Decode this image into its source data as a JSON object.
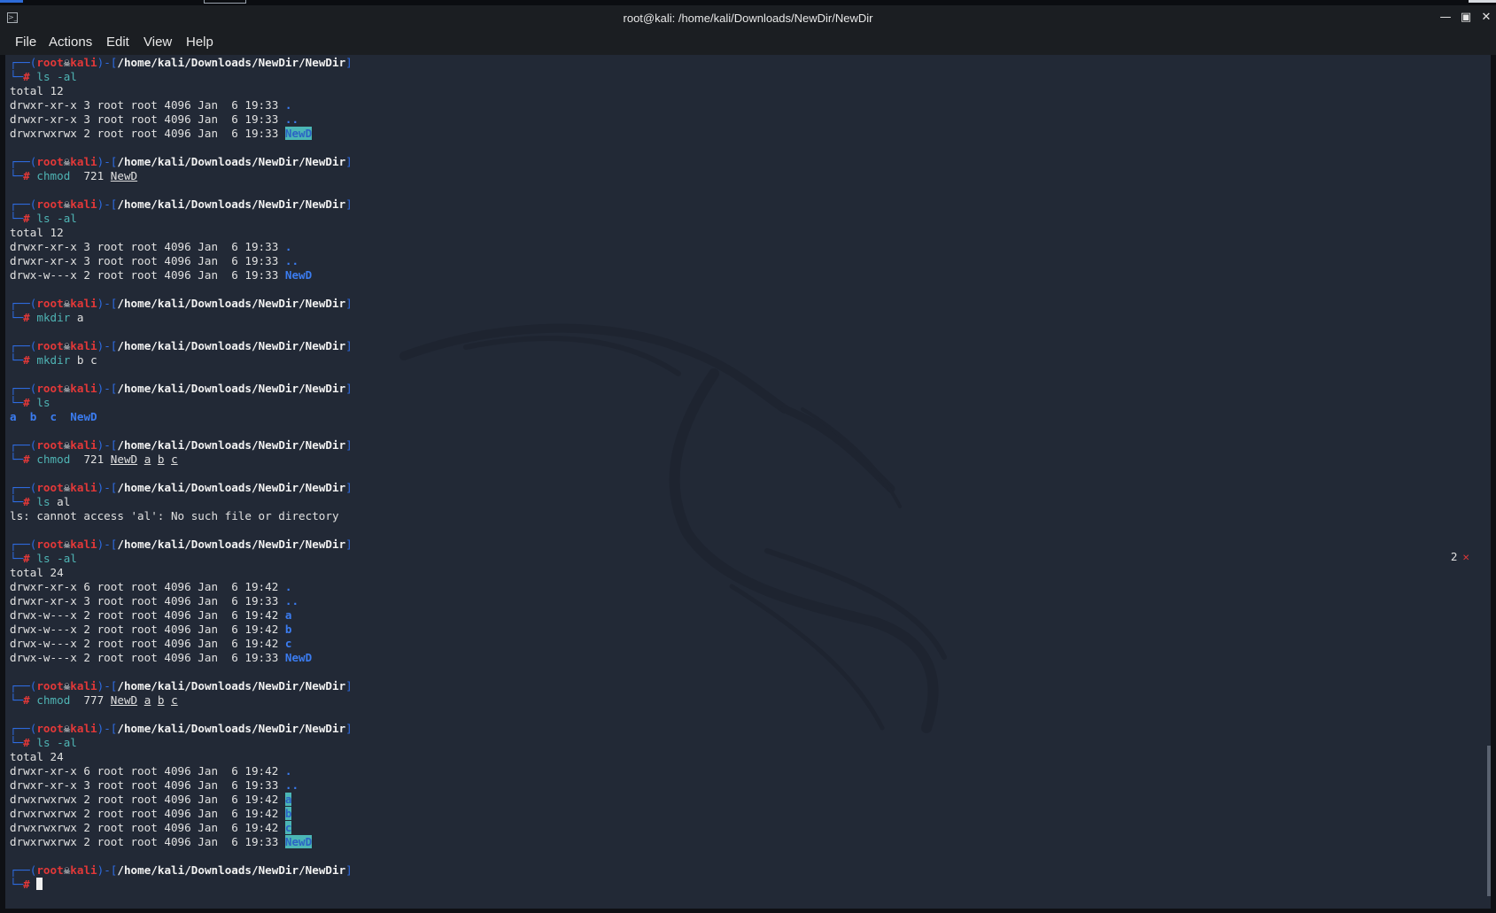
{
  "window": {
    "title": "root@kali: /home/kali/Downloads/NewDir/NewDir",
    "minimize_icon": "minimize-icon",
    "maximize_icon": "maximize-icon",
    "close_icon": "close-icon"
  },
  "menu": {
    "file": "File",
    "actions": "Actions",
    "edit": "Edit",
    "view": "View",
    "help": "Help"
  },
  "prompt": {
    "user": "root",
    "host": "kali",
    "path": "/home/kali/Downloads/NewDir/NewDir",
    "symbol": "#",
    "open": "┌──(",
    "mid": ")-[",
    "close": "]",
    "second": "└─",
    "skull_icon": "skull-icon"
  },
  "blocks": [
    {
      "command": "ls",
      "args": [
        {
          "text": "-al",
          "style": "opt"
        }
      ],
      "output": [
        {
          "text": "total 12"
        },
        {
          "text": "drwxr-xr-x 3 root root 4096 Jan  6 19:33 ",
          "name": ".",
          "style": "dir"
        },
        {
          "text": "drwxr-xr-x 3 root root 4096 Jan  6 19:33 ",
          "name": "..",
          "style": "dir"
        },
        {
          "text": "drwxrwxrwx 2 root root 4096 Jan  6 19:33 ",
          "name": "NewD",
          "style": "hldir"
        }
      ]
    },
    {
      "command": "chmod",
      "args": [
        {
          "text": "721",
          "style": "plain"
        },
        {
          "text": "NewD",
          "style": "under"
        }
      ],
      "output": []
    },
    {
      "command": "ls",
      "args": [
        {
          "text": "-al",
          "style": "opt"
        }
      ],
      "output": [
        {
          "text": "total 12"
        },
        {
          "text": "drwxr-xr-x 3 root root 4096 Jan  6 19:33 ",
          "name": ".",
          "style": "dir"
        },
        {
          "text": "drwxr-xr-x 3 root root 4096 Jan  6 19:33 ",
          "name": "..",
          "style": "dir"
        },
        {
          "text": "drwx-w---x 2 root root 4096 Jan  6 19:33 ",
          "name": "NewD",
          "style": "dir"
        }
      ]
    },
    {
      "command": "mkdir",
      "args": [
        {
          "text": "a",
          "style": "plain"
        }
      ],
      "output": []
    },
    {
      "command": "mkdir",
      "args": [
        {
          "text": "b",
          "style": "plain"
        },
        {
          "text": "c",
          "style": "plain"
        }
      ],
      "output": []
    },
    {
      "command": "ls",
      "args": [],
      "output": [
        {
          "text": "",
          "items": [
            "a",
            "b",
            "c",
            "NewD"
          ]
        }
      ]
    },
    {
      "command": "chmod",
      "args": [
        {
          "text": "721",
          "style": "plain"
        },
        {
          "text": "NewD",
          "style": "under"
        },
        {
          "text": "a",
          "style": "under"
        },
        {
          "text": "b",
          "style": "under"
        },
        {
          "text": "c",
          "style": "under"
        }
      ],
      "output": []
    },
    {
      "command": "ls",
      "args": [
        {
          "text": "al",
          "style": "plain"
        }
      ],
      "output": [
        {
          "text": "ls: cannot access 'al': No such file or directory"
        }
      ]
    },
    {
      "command": "ls",
      "args": [
        {
          "text": "-al",
          "style": "opt"
        }
      ],
      "output": [
        {
          "text": "total 24"
        },
        {
          "text": "drwxr-xr-x 6 root root 4096 Jan  6 19:42 ",
          "name": ".",
          "style": "dir"
        },
        {
          "text": "drwxr-xr-x 3 root root 4096 Jan  6 19:33 ",
          "name": "..",
          "style": "dir"
        },
        {
          "text": "drwx-w---x 2 root root 4096 Jan  6 19:42 ",
          "name": "a",
          "style": "dir"
        },
        {
          "text": "drwx-w---x 2 root root 4096 Jan  6 19:42 ",
          "name": "b",
          "style": "dir"
        },
        {
          "text": "drwx-w---x 2 root root 4096 Jan  6 19:42 ",
          "name": "c",
          "style": "dir"
        },
        {
          "text": "drwx-w---x 2 root root 4096 Jan  6 19:33 ",
          "name": "NewD",
          "style": "dir"
        }
      ]
    },
    {
      "command": "chmod",
      "args": [
        {
          "text": "777",
          "style": "plain"
        },
        {
          "text": "NewD",
          "style": "under"
        },
        {
          "text": "a",
          "style": "under"
        },
        {
          "text": "b",
          "style": "under"
        },
        {
          "text": "c",
          "style": "under"
        }
      ],
      "output": []
    },
    {
      "command": "ls",
      "args": [
        {
          "text": "-al",
          "style": "opt"
        }
      ],
      "output": [
        {
          "text": "total 24"
        },
        {
          "text": "drwxr-xr-x 6 root root 4096 Jan  6 19:42 ",
          "name": ".",
          "style": "dir"
        },
        {
          "text": "drwxr-xr-x 3 root root 4096 Jan  6 19:33 ",
          "name": "..",
          "style": "dir"
        },
        {
          "text": "drwxrwxrwx 2 root root 4096 Jan  6 19:42 ",
          "name": "a",
          "style": "hldir"
        },
        {
          "text": "drwxrwxrwx 2 root root 4096 Jan  6 19:42 ",
          "name": "b",
          "style": "hldir"
        },
        {
          "text": "drwxrwxrwx 2 root root 4096 Jan  6 19:42 ",
          "name": "c",
          "style": "hldir"
        },
        {
          "text": "drwxrwxrwx 2 root root 4096 Jan  6 19:33 ",
          "name": "NewD",
          "style": "hldir"
        }
      ]
    }
  ],
  "status": {
    "count": "2",
    "icon": "close-x-icon"
  },
  "colors": {
    "terminal_bg": "#222936",
    "prompt_blue": "#2e6ce2",
    "prompt_red": "#e33838",
    "command_cyan": "#4fb4b4",
    "dir_blue": "#3b7cf0",
    "highlight_bg": "#4bb6b6"
  }
}
